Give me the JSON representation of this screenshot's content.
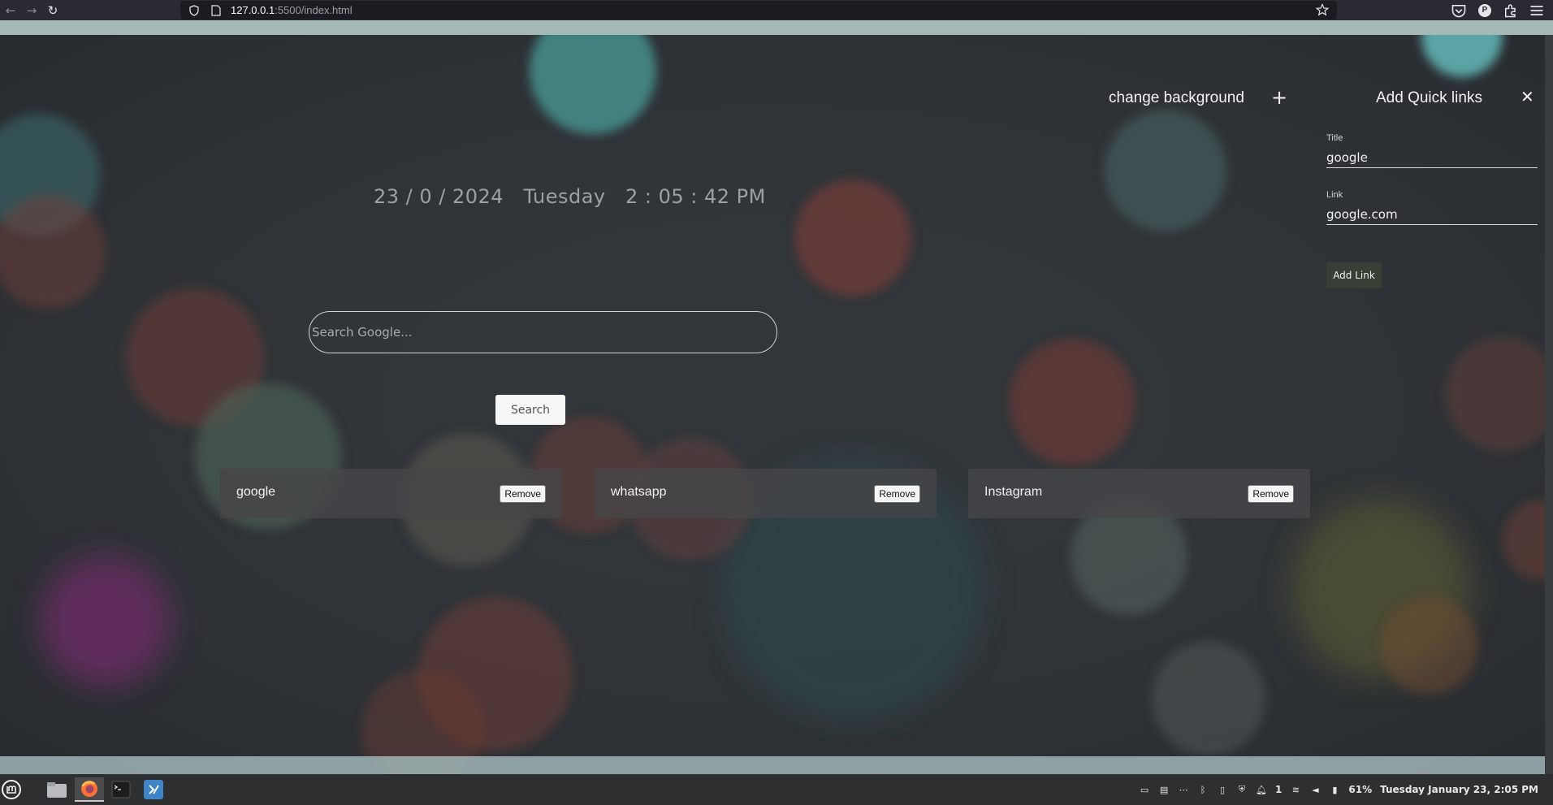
{
  "browser": {
    "url_host": "127.0.0.1",
    "url_rest": ":5500/index.html",
    "profile_initial": "P"
  },
  "main": {
    "datetime": "23 / 0 / 2024   Tuesday   2 : 05 : 42 PM",
    "search_placeholder": "Search Google...",
    "search_button": "Search",
    "change_background": "change background",
    "quick_links": [
      {
        "title": "google",
        "remove": "Remove"
      },
      {
        "title": "whatsapp",
        "remove": "Remove"
      },
      {
        "title": "Instagram",
        "remove": "Remove"
      }
    ]
  },
  "panel": {
    "title": "Add Quick links",
    "title_label": "Title",
    "title_value": "google",
    "link_label": "Link",
    "link_value": "google.com",
    "add_button": "Add Link"
  },
  "taskbar": {
    "notifications": "1",
    "battery": "61%",
    "clock": "Tuesday January 23,  2:05 PM"
  },
  "colors": {
    "panel_button": "#384036",
    "card_bg": "#464648",
    "taskbar_bg": "#2e2f30"
  }
}
